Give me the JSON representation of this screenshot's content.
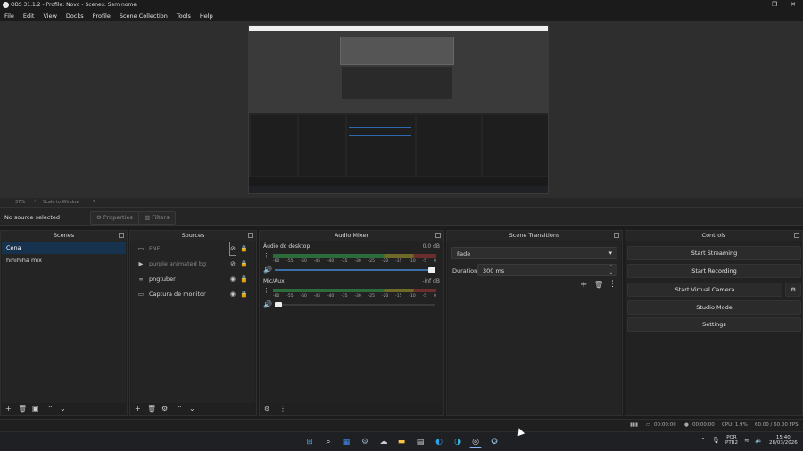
{
  "window": {
    "title": "OBS 31.1.2 - Profile: Novo - Scenes: Sem nome"
  },
  "menu": [
    "File",
    "Edit",
    "View",
    "Docks",
    "Profile",
    "Scene Collection",
    "Tools",
    "Help"
  ],
  "zoom": {
    "percent": "37%",
    "mode": "Scale to Window"
  },
  "source_toolbar": {
    "status": "No source selected",
    "properties": "Properties",
    "filters": "Filters"
  },
  "docks": {
    "scenes": {
      "title": "Scenes",
      "items": [
        "Cena",
        "hihihiha mix"
      ]
    },
    "sources": {
      "title": "Sources",
      "items": [
        {
          "name": "FNF",
          "icon": "window-icon",
          "visible": false
        },
        {
          "name": "purple animated bg",
          "icon": "media-play-icon",
          "visible": false
        },
        {
          "name": "pngtuber",
          "icon": "link-icon",
          "visible": true
        },
        {
          "name": "Captura de monitor",
          "icon": "monitor-icon",
          "visible": true
        }
      ]
    },
    "audio": {
      "title": "Audio Mixer",
      "channels": [
        {
          "name": "Áudio do desktop",
          "level": "0.0 dB",
          "volume": 1.0
        },
        {
          "name": "Mic/Aux",
          "level": "-inf dB",
          "volume": 0.0
        }
      ],
      "scale": [
        "-60",
        "-55",
        "-50",
        "-45",
        "-40",
        "-35",
        "-30",
        "-25",
        "-20",
        "-15",
        "-10",
        "-5",
        "0"
      ]
    },
    "transitions": {
      "title": "Scene Transitions",
      "selected": "Fade",
      "duration_label": "Duration",
      "duration": "300 ms"
    },
    "controls": {
      "title": "Controls",
      "start_streaming": "Start Streaming",
      "start_recording": "Start Recording",
      "start_virtual_camera": "Start Virtual Camera",
      "studio_mode": "Studio Mode",
      "settings": "Settings"
    }
  },
  "status": {
    "stream_time": "00:00:00",
    "rec_time": "00:00:00",
    "cpu": "CPU: 1.9%",
    "fps": "60.00 / 60.00 FPS"
  },
  "taskbar": {
    "lang": "POR",
    "layout": "PTB2",
    "time": "15:40",
    "date": "28/03/2026"
  },
  "colors": {
    "accent": "#3a6ea5",
    "meter_green": "#2d6b3a",
    "meter_yellow": "#6e6a28",
    "meter_red": "#6b2d2d"
  }
}
